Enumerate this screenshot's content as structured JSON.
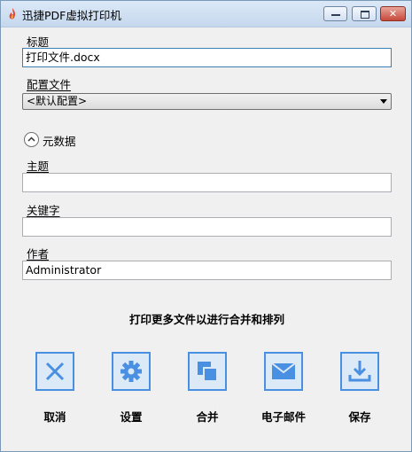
{
  "window": {
    "title": "迅捷PDF虚拟打印机"
  },
  "form": {
    "title_label": "标题",
    "title_value": "打印文件.docx",
    "config_label": "配置文件",
    "config_selected": "<默认配置>",
    "metadata_toggle": "元数据",
    "subject_label": "主题",
    "subject_value": "",
    "keywords_label": "关键字",
    "keywords_value": "",
    "author_label": "作者",
    "author_value": "Administrator"
  },
  "promo_text": "打印更多文件以进行合并和排列",
  "actions": [
    {
      "label": "取消",
      "icon": "cancel-icon"
    },
    {
      "label": "设置",
      "icon": "gear-icon"
    },
    {
      "label": "合并",
      "icon": "merge-icon"
    },
    {
      "label": "电子邮件",
      "icon": "mail-icon"
    },
    {
      "label": "保存",
      "icon": "download-icon"
    }
  ],
  "colors": {
    "accent": "#4a90e2",
    "icon_bg": "#dce9f7"
  }
}
